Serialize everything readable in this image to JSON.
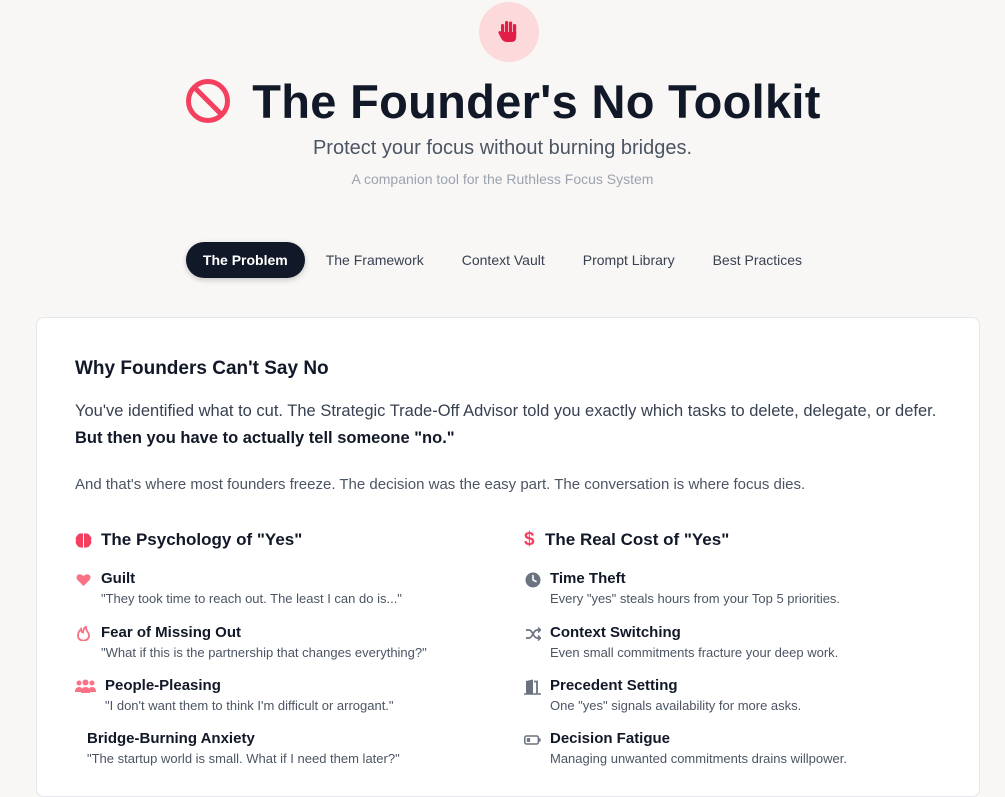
{
  "header": {
    "title": "The Founder's No Toolkit",
    "subtitle": "Protect your focus without burning bridges.",
    "companion": "A companion tool for the Ruthless Focus System",
    "badge_icon": "raised-hand-icon",
    "title_icon": "prohibited-icon"
  },
  "colors": {
    "accent": "#f43f5e",
    "badge_bg": "#fcd9da",
    "dark": "#111827",
    "page_bg": "#f8f7f5"
  },
  "tabs": [
    {
      "label": "The Problem",
      "active": true
    },
    {
      "label": "The Framework",
      "active": false
    },
    {
      "label": "Context Vault",
      "active": false
    },
    {
      "label": "Prompt Library",
      "active": false
    },
    {
      "label": "Best Practices",
      "active": false
    }
  ],
  "problem": {
    "heading": "Why Founders Can't Say No",
    "lead_text": "You've identified what to cut. The Strategic Trade-Off Advisor told you exactly which tasks to delete, delegate, or defer. ",
    "lead_bold": "But then you have to actually tell someone \"no.\"",
    "note": "And that's where most founders freeze. The decision was the easy part. The conversation is where focus dies.",
    "psychology": {
      "title": "The Psychology of \"Yes\"",
      "icon": "brain-icon",
      "items": [
        {
          "icon": "heart-icon",
          "title": "Guilt",
          "desc": "\"They took time to reach out. The least I can do is...\""
        },
        {
          "icon": "flame-icon",
          "title": "Fear of Missing Out",
          "desc": "\"What if this is the partnership that changes everything?\""
        },
        {
          "icon": "users-icon",
          "title": "People-Pleasing",
          "desc": "\"I don't want them to think I'm difficult or arrogant.\""
        },
        {
          "icon": "bridge-icon",
          "title": "Bridge-Burning Anxiety",
          "desc": "\"The startup world is small. What if I need them later?\""
        }
      ]
    },
    "cost": {
      "title": "The Real Cost of \"Yes\"",
      "icon": "dollar-icon",
      "items": [
        {
          "icon": "clock-icon",
          "title": "Time Theft",
          "desc": "Every \"yes\" steals hours from your Top 5 priorities."
        },
        {
          "icon": "shuffle-icon",
          "title": "Context Switching",
          "desc": "Even small commitments fracture your deep work."
        },
        {
          "icon": "door-icon",
          "title": "Precedent Setting",
          "desc": "One \"yes\" signals availability for more asks."
        },
        {
          "icon": "battery-low-icon",
          "title": "Decision Fatigue",
          "desc": "Managing unwanted commitments drains willpower."
        }
      ]
    }
  }
}
